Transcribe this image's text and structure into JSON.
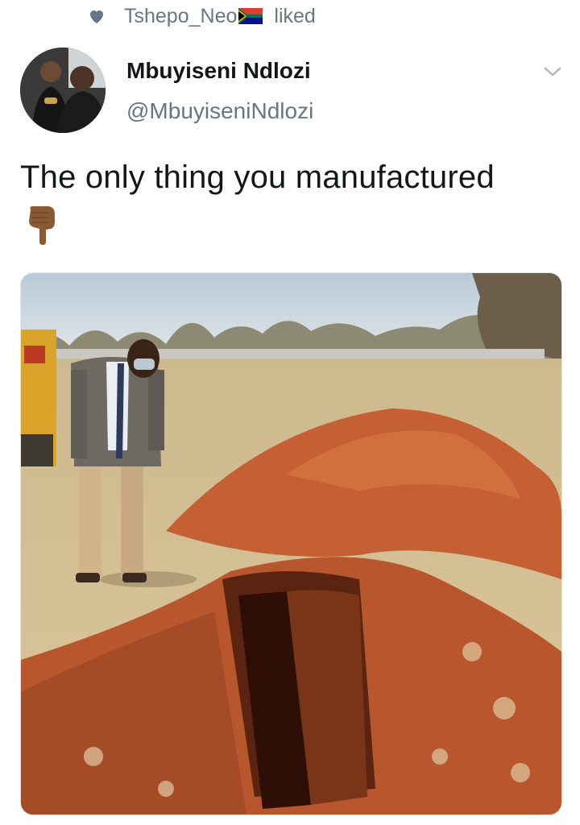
{
  "social_context": {
    "icon": "heart-icon",
    "user": "Tshepo_Neo",
    "flag": "south-africa-flag-icon",
    "action": "liked"
  },
  "tweet": {
    "display_name": "Mbuyiseni Ndlozi",
    "handle": "@MbuyiseniNdlozi",
    "text": "The only thing you manufactured",
    "emoji": "backhand-index-pointing-down",
    "menu_icon": "chevron-down-icon"
  },
  "media": {
    "icon": "photo-grave",
    "colors": {
      "sky": "#cfdbe3",
      "grass": "#d8c49a",
      "soil": "#b8562e"
    }
  },
  "colors": {
    "text_primary": "#14171a",
    "text_secondary": "#657786"
  }
}
